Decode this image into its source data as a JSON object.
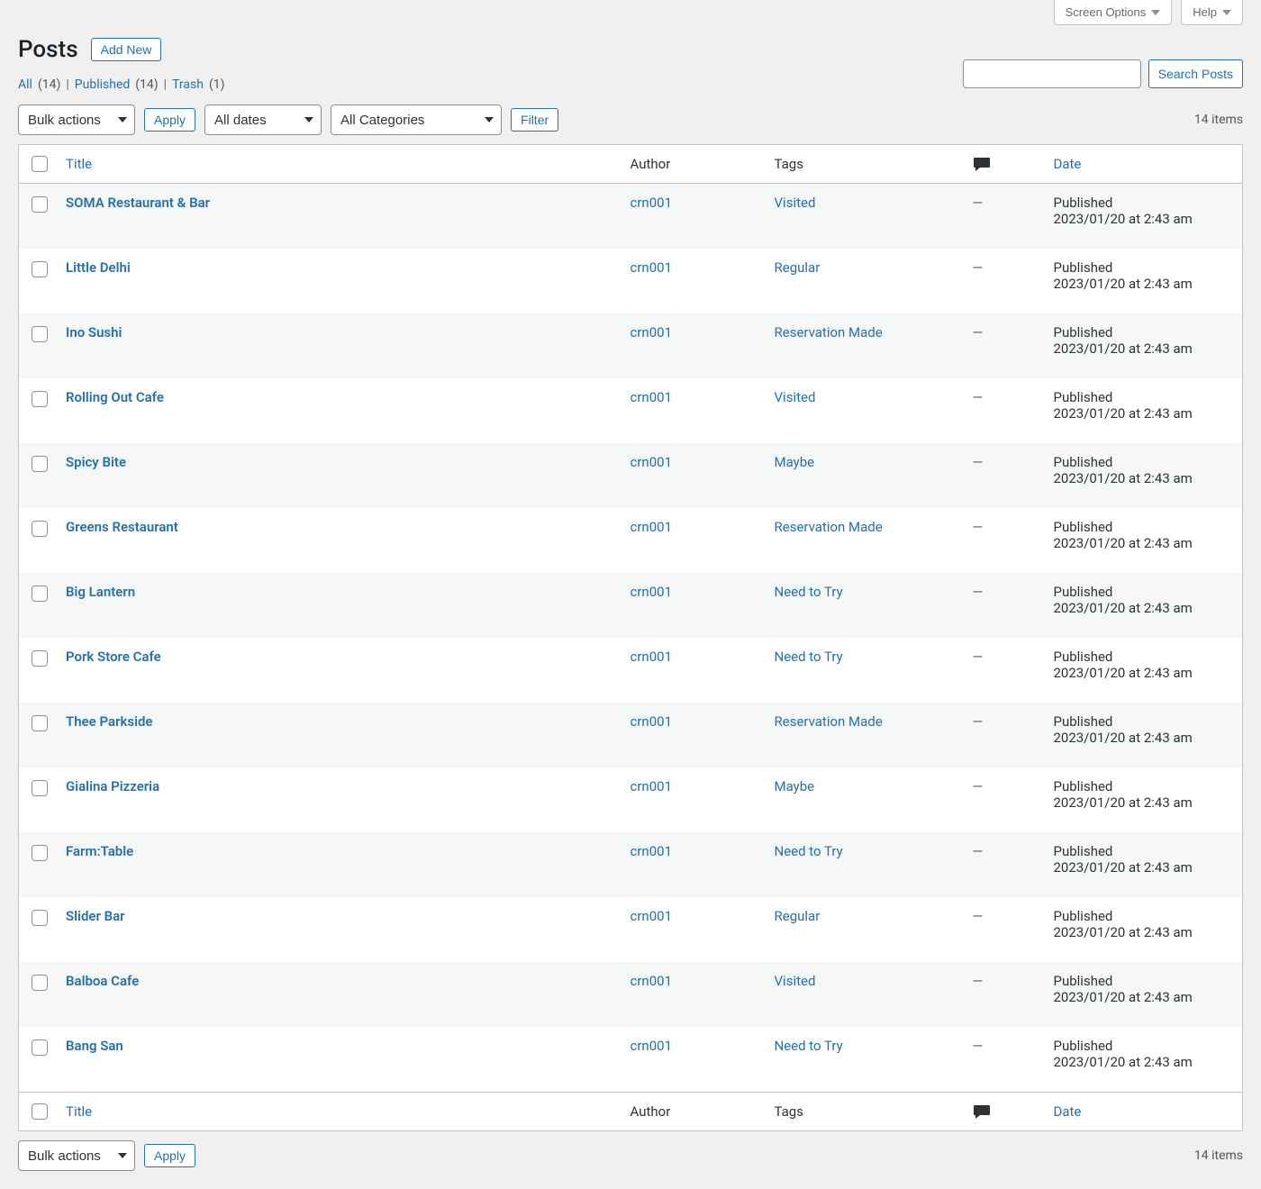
{
  "tabs": {
    "screen_options": "Screen Options",
    "help": "Help"
  },
  "header": {
    "title": "Posts",
    "add_new": "Add New"
  },
  "filters": {
    "all_label": "All",
    "all_count": "(14)",
    "published_label": "Published",
    "published_count": "(14)",
    "trash_label": "Trash",
    "trash_count": "(1)",
    "sep": "|"
  },
  "search": {
    "button": "Search Posts"
  },
  "bulk": {
    "label": "Bulk actions",
    "apply": "Apply"
  },
  "date_filter": "All dates",
  "cat_filter": "All Categories",
  "filter_btn": "Filter",
  "items_count": "14 items",
  "columns": {
    "title": "Title",
    "author": "Author",
    "tags": "Tags",
    "date": "Date"
  },
  "status_label": "Published",
  "date_label": "2023/01/20 at 2:43 am",
  "dash": "—",
  "posts": [
    {
      "title": "SOMA Restaurant & Bar",
      "author": "crn001",
      "tag": "Visited"
    },
    {
      "title": "Little Delhi",
      "author": "crn001",
      "tag": "Regular"
    },
    {
      "title": "Ino Sushi",
      "author": "crn001",
      "tag": "Reservation Made"
    },
    {
      "title": "Rolling Out Cafe",
      "author": "crn001",
      "tag": "Visited"
    },
    {
      "title": "Spicy Bite",
      "author": "crn001",
      "tag": "Maybe"
    },
    {
      "title": "Greens Restaurant",
      "author": "crn001",
      "tag": "Reservation Made"
    },
    {
      "title": "Big Lantern",
      "author": "crn001",
      "tag": "Need to Try"
    },
    {
      "title": "Pork Store Cafe",
      "author": "crn001",
      "tag": "Need to Try"
    },
    {
      "title": "Thee Parkside",
      "author": "crn001",
      "tag": "Reservation Made"
    },
    {
      "title": "Gialina Pizzeria",
      "author": "crn001",
      "tag": "Maybe"
    },
    {
      "title": "Farm:Table",
      "author": "crn001",
      "tag": "Need to Try"
    },
    {
      "title": "Slider Bar",
      "author": "crn001",
      "tag": "Regular"
    },
    {
      "title": "Balboa Cafe",
      "author": "crn001",
      "tag": "Visited"
    },
    {
      "title": "Bang San",
      "author": "crn001",
      "tag": "Need to Try"
    }
  ]
}
